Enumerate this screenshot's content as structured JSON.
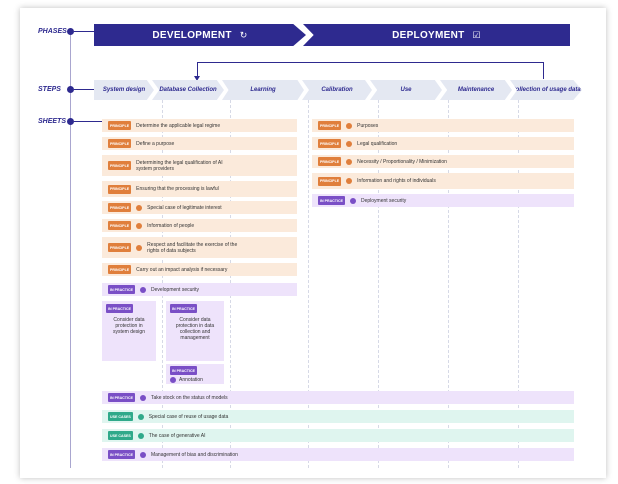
{
  "row_labels": {
    "phases": "PHASES",
    "steps": "STEPS",
    "sheets": "SHEETS"
  },
  "phases": [
    {
      "label": "DEVELOPMENT",
      "icon": "refresh-icon"
    },
    {
      "label": "DEPLOYMENT",
      "icon": "check-box-icon"
    }
  ],
  "steps": [
    "System design",
    "Database Collection",
    "Learning",
    "Calibration",
    "Use",
    "Maintenance",
    "Collection of usage data"
  ],
  "badges": {
    "principle": "PRINCIPLE",
    "practice": "IN PRACTICE",
    "usecase": "USE CASES"
  },
  "colors": {
    "primary": "#2e2a8f",
    "principle": "#e07f3c",
    "practice": "#7a4fc6",
    "usecase": "#2fa98a"
  },
  "development_sheets": [
    "Determine the applicable legal regime",
    "Define a purpose",
    "Determining the legal qualification of AI system providers",
    "Ensuring that the processing is lawful",
    "Special case of legitimate interest",
    "Information of people",
    "Respect and facilitate the exercise of the rights of data subjects",
    "Carry out an impact analysis if necessary",
    "Development security"
  ],
  "deployment_sheets": [
    "Purposes",
    "Legal qualification",
    "Necessity / Proportionality / Minimization",
    "Information and rights of individuals",
    "Deployment security"
  ],
  "practice_columns": [
    "Consider data protection in system design",
    "Consider data protection in data collection and management",
    "Annotation"
  ],
  "bottom_sheets": [
    "Take stock on the status of models",
    "Special case of reuse of usage data",
    "The case of generative AI",
    "Management of bias and discrimination"
  ]
}
